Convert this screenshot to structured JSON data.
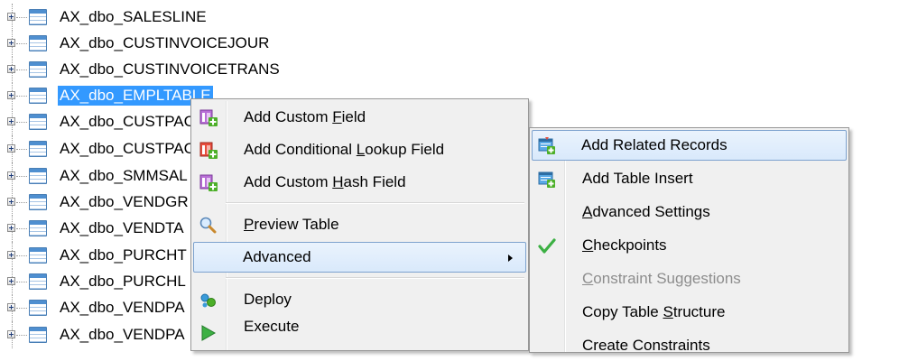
{
  "tree": {
    "items": [
      {
        "label": "AX_dbo_SALESLINE"
      },
      {
        "label": "AX_dbo_CUSTINVOICEJOUR"
      },
      {
        "label": "AX_dbo_CUSTINVOICETRANS"
      },
      {
        "label": "AX_dbo_EMPLTABLE",
        "selected": true
      },
      {
        "label": "AX_dbo_CUSTPAC"
      },
      {
        "label": "AX_dbo_CUSTPAC"
      },
      {
        "label": "AX_dbo_SMMSAL"
      },
      {
        "label": "AX_dbo_VENDGR"
      },
      {
        "label": "AX_dbo_VENDTA"
      },
      {
        "label": "AX_dbo_PURCHT"
      },
      {
        "label": "AX_dbo_PURCHL"
      },
      {
        "label": "AX_dbo_VENDPA"
      },
      {
        "label": "AX_dbo_VENDPA"
      }
    ]
  },
  "context_menu": {
    "items": [
      {
        "pre": "Add Custom ",
        "acc": "F",
        "post": "ield",
        "icon": "add-custom-field-icon"
      },
      {
        "pre": "Add Conditional ",
        "acc": "L",
        "post": "ookup Field",
        "icon": "add-lookup-field-icon"
      },
      {
        "pre": "Add Custom ",
        "acc": "H",
        "post": "ash Field",
        "icon": "add-hash-field-icon"
      },
      {
        "pre": "",
        "acc": "P",
        "post": "review Table",
        "icon": "magnifier-icon"
      },
      {
        "pre": "Advanced",
        "acc": "",
        "post": "",
        "icon": "",
        "submenu": true
      },
      {
        "pre": "Deploy",
        "acc": "",
        "post": "",
        "icon": "deploy-icon"
      },
      {
        "pre": "Execute",
        "acc": "",
        "post": "",
        "icon": "execute-icon"
      }
    ]
  },
  "submenu": {
    "items": [
      {
        "pre": "Add Related Records",
        "acc": "",
        "post": "",
        "icon": "add-related-records-icon"
      },
      {
        "pre": "Add Table Insert",
        "acc": "",
        "post": "",
        "icon": "add-table-insert-icon"
      },
      {
        "pre": "",
        "acc": "A",
        "post": "dvanced Settings",
        "icon": ""
      },
      {
        "pre": "",
        "acc": "C",
        "post": "heckpoints",
        "icon": "checkmark-icon"
      },
      {
        "pre": "",
        "acc": "C",
        "post": "onstraint Suggestions",
        "icon": "",
        "disabled": true
      },
      {
        "pre": "Copy Table ",
        "acc": "S",
        "post": "tructure",
        "icon": ""
      },
      {
        "pre": "Create Constraints",
        "acc": "",
        "post": "",
        "icon": ""
      }
    ]
  },
  "colors": {
    "selection": "#3399ff",
    "menu_bg": "#f0f0f0",
    "hover_border": "#7da2ce",
    "checkmark": "#3cb043"
  }
}
